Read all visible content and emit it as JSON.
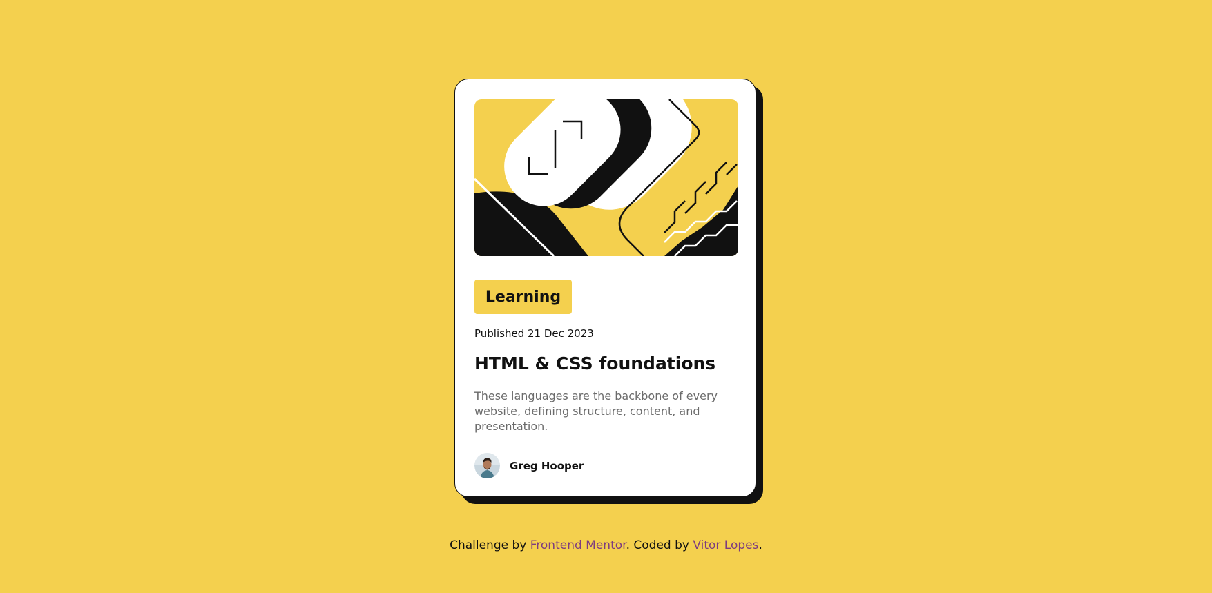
{
  "card": {
    "tag": "Learning",
    "published": "Published 21 Dec 2023",
    "title": "HTML & CSS foundations",
    "description": "These languages are the backbone of every website, defining structure, content, and presentation.",
    "author": "Greg Hooper"
  },
  "footer": {
    "prefix": "Challenge by ",
    "link1": "Frontend Mentor",
    "middle": ". Coded by ",
    "link2": "Vitor Lopes",
    "suffix": "."
  },
  "colors": {
    "background": "#f4d04e",
    "card": "#ffffff",
    "ink": "#111111",
    "muted": "#6b6b6b",
    "link": "#7d3c7f"
  },
  "icons": {
    "hero": "code-illustration",
    "avatar": "author-avatar"
  }
}
